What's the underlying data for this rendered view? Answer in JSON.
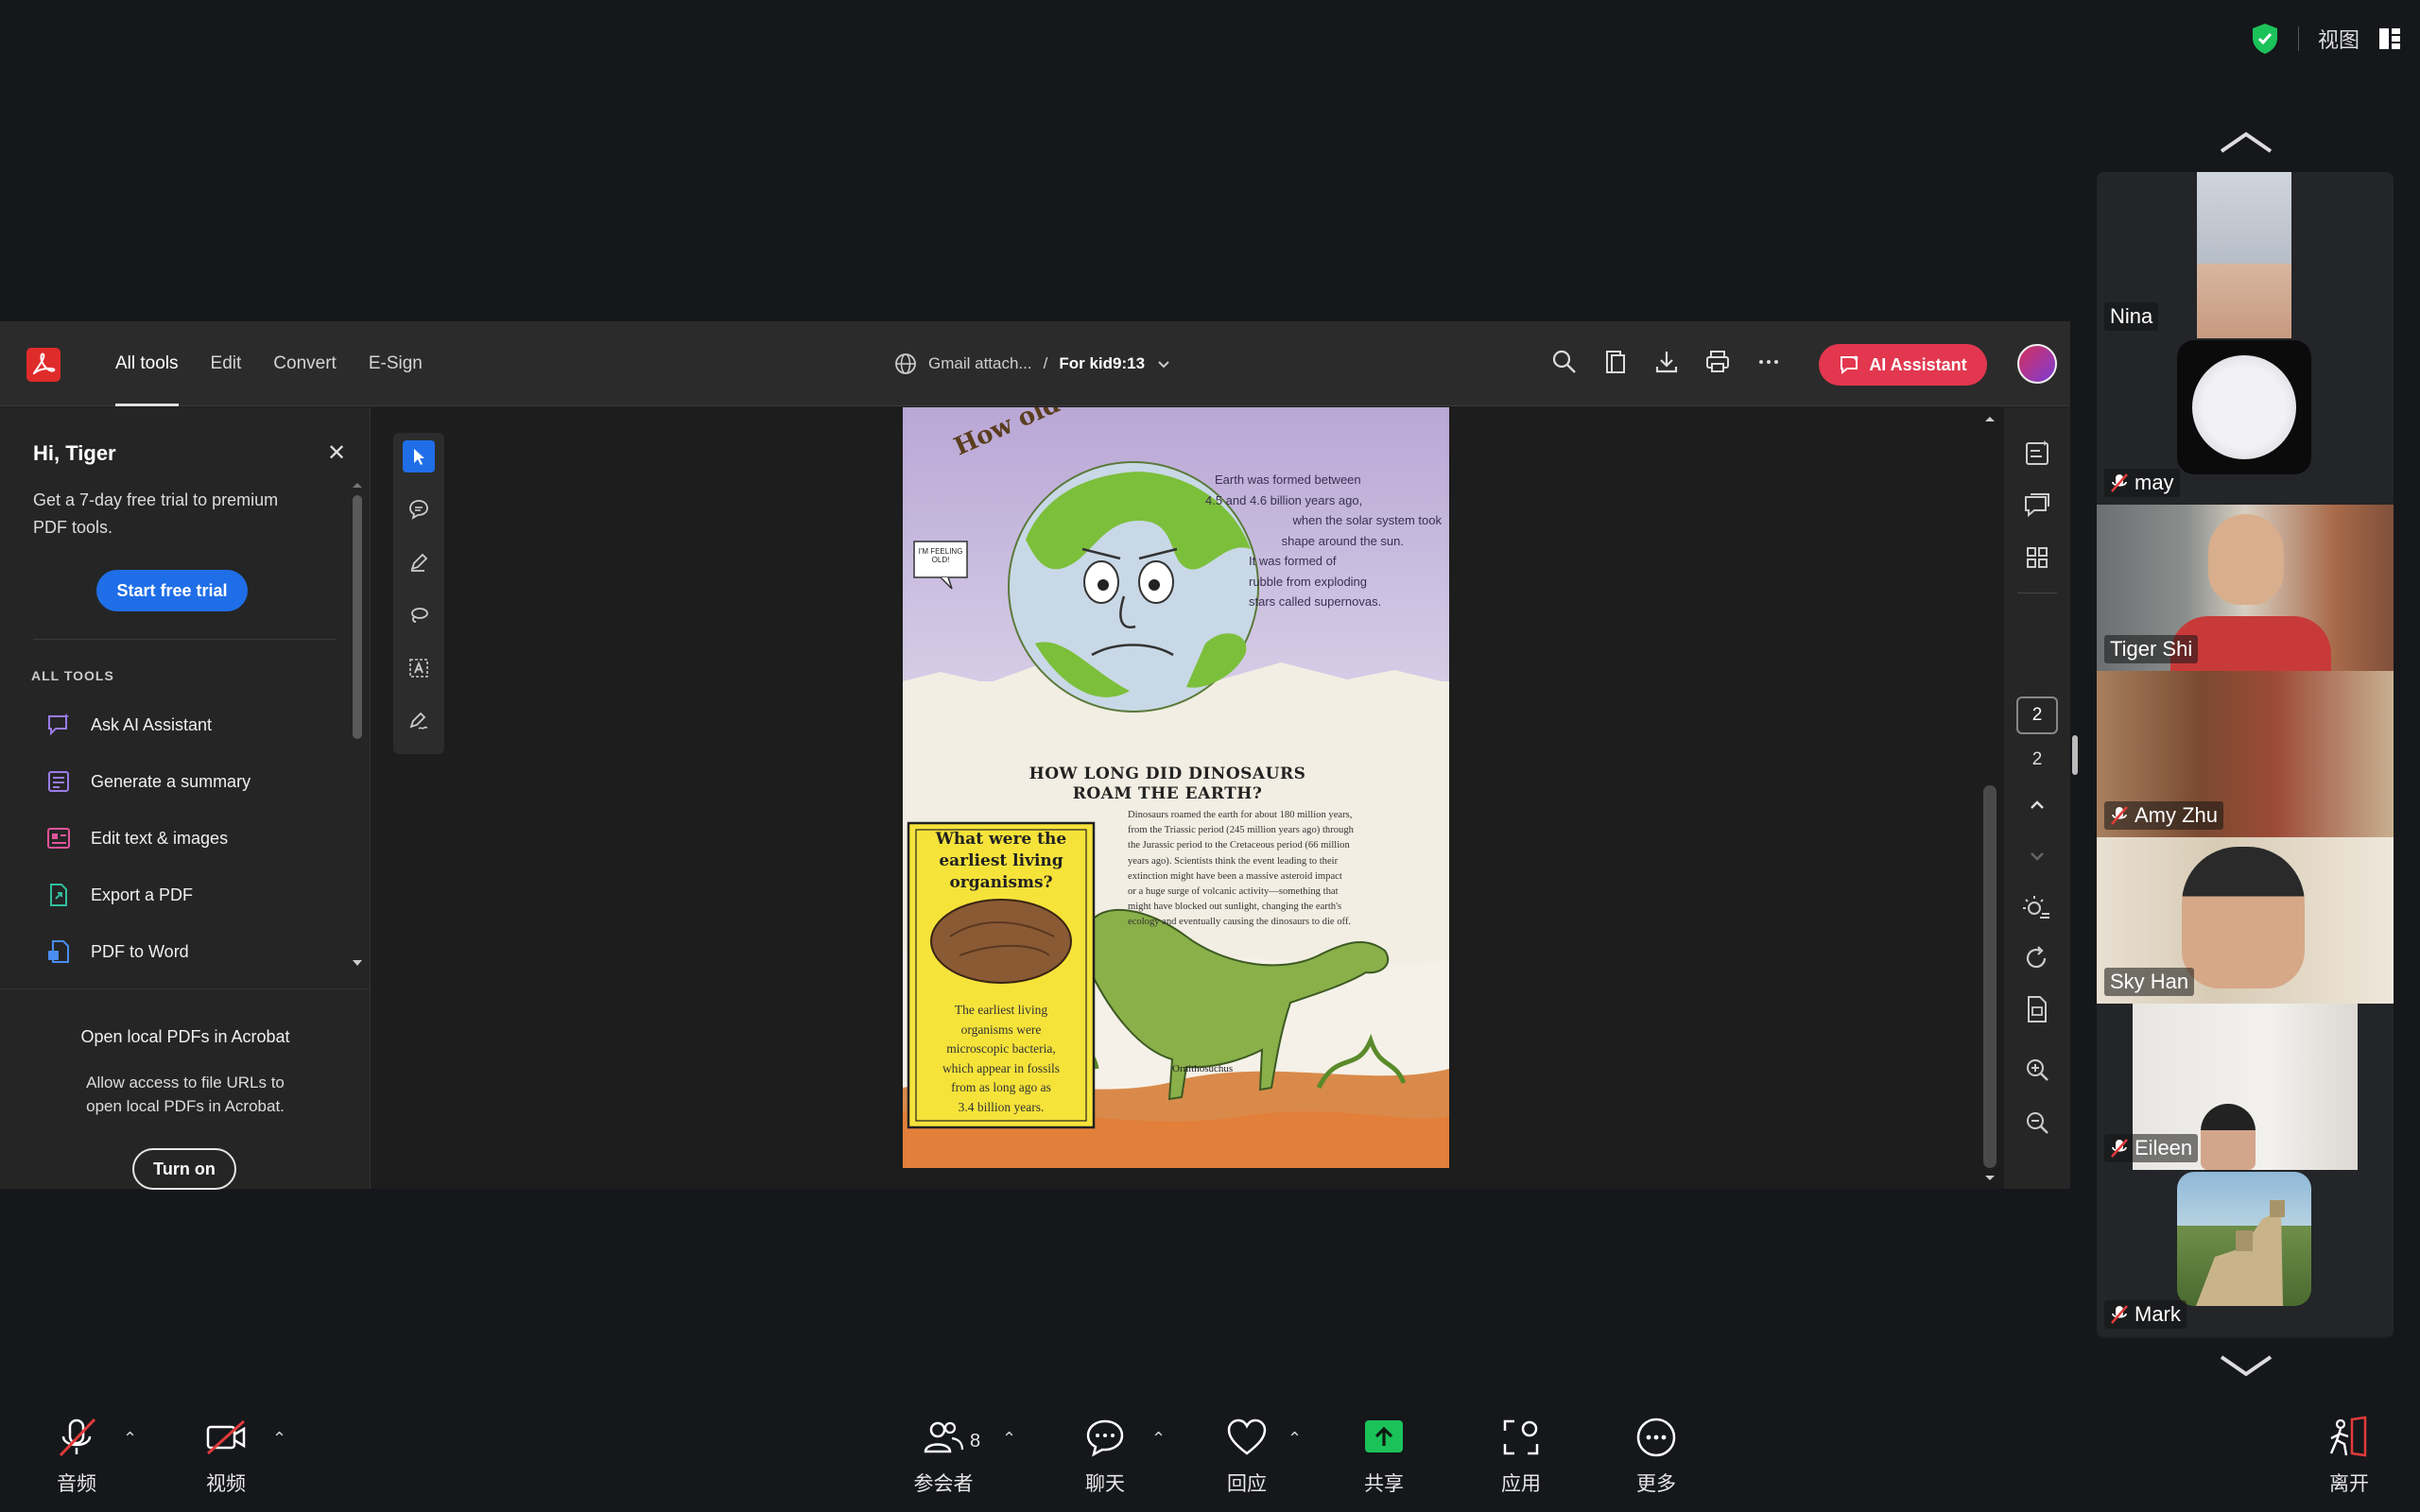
{
  "topbar": {
    "view_label": "视图"
  },
  "acrobat": {
    "nav": [
      "All tools",
      "Edit",
      "Convert",
      "E-Sign"
    ],
    "breadcrumb": {
      "source": "Gmail attach...",
      "separator": "/",
      "file": "For kid9:13"
    },
    "ai_button": "AI Assistant",
    "panel": {
      "greeting": "Hi, Tiger",
      "trial_text": "Get a 7-day free trial to premium PDF tools.",
      "trial_button": "Start free trial",
      "section": "ALL TOOLS",
      "tools": [
        "Ask AI Assistant",
        "Generate a summary",
        "Edit text & images",
        "Export a PDF",
        "PDF to Word"
      ],
      "local_title": "Open local PDFs in Acrobat",
      "local_desc": "Allow access to file URLs to open local PDFs in Acrobat.",
      "turn_on": "Turn on"
    },
    "page_current": "2",
    "page_total": "2",
    "document": {
      "headline": "How old is Earth?",
      "speech": "I'M FEELING OLD!",
      "intro": [
        "Earth was formed between",
        "4.5 and 4.6 billion years ago,",
        "when the solar system took",
        "shape around the sun.",
        "It was formed of",
        "rubble from exploding",
        "stars called supernovas."
      ],
      "dino_title": [
        "HOW LONG DID DINOSAURS",
        "ROAM THE EARTH?"
      ],
      "dino_text": [
        "Dinosaurs roamed the earth for about 180 million years,",
        "from the Triassic period (245 million years ago) through",
        "the Jurassic period to the Cretaceous period (66 million",
        "years ago). Scientists think the event leading to their",
        "extinction might have been a massive asteroid impact",
        "or a huge surge of volcanic activity—something that",
        "might have blocked out sunlight, changing the earth's",
        "ecology and eventually causing the dinosaurs to die off."
      ],
      "box_title": [
        "What were the",
        "earliest living",
        "organisms?"
      ],
      "box_text": [
        "The earliest living",
        "organisms were",
        "microscopic bacteria,",
        "which appear in fossils",
        "from as long ago as",
        "3.4 billion years."
      ],
      "dino_label": "Ornithosuchus"
    }
  },
  "participants": [
    {
      "name": "Nina",
      "muted": false,
      "active": false
    },
    {
      "name": "may",
      "muted": true,
      "active": false
    },
    {
      "name": "Tiger Shi",
      "muted": false,
      "active": true
    },
    {
      "name": "Amy Zhu",
      "muted": true,
      "active": false
    },
    {
      "name": "Sky Han",
      "muted": false,
      "active": false
    },
    {
      "name": "Eileen",
      "muted": true,
      "active": false
    },
    {
      "name": "Mark",
      "muted": true,
      "active": false
    }
  ],
  "bottombar": {
    "audio": "音频",
    "video": "视频",
    "participants": "参会者",
    "participant_count": "8",
    "chat": "聊天",
    "react": "回应",
    "share": "共享",
    "apps": "应用",
    "more": "更多",
    "leave": "离开"
  },
  "colors": {
    "accent_blue": "#1f6ee8",
    "ai_red": "#e2374f",
    "share_green": "#1bc25a",
    "active_outline": "#3ad36b"
  }
}
